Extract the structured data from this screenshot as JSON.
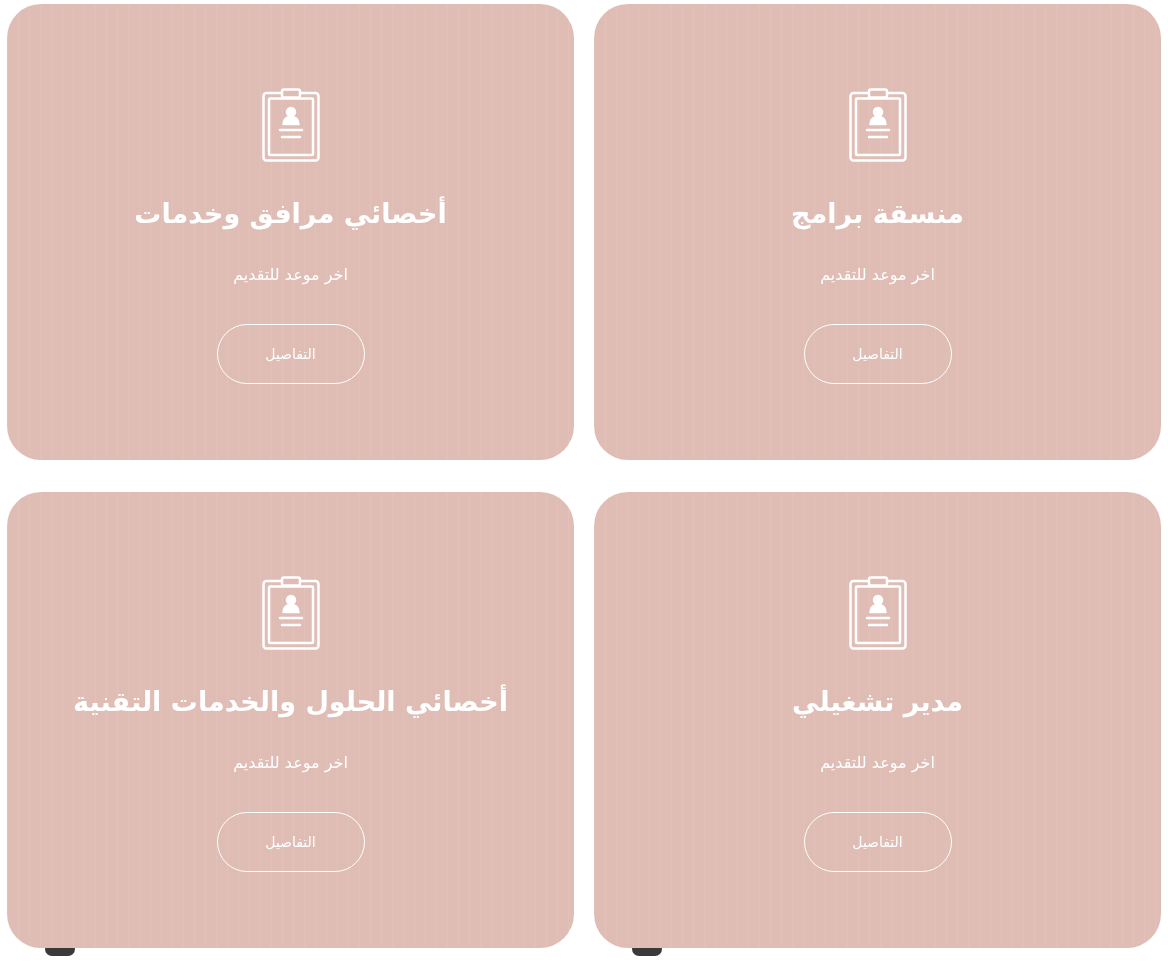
{
  "cards": [
    {
      "title": "منسقة برامج",
      "subtitle": "اخر موعد للتقديم",
      "button": "التفاصيل"
    },
    {
      "title": "أخصائي مرافق وخدمات",
      "subtitle": "اخر موعد للتقديم",
      "button": "التفاصيل"
    },
    {
      "title": "مدير تشغيلي",
      "subtitle": "اخر موعد للتقديم",
      "button": "التفاصيل"
    },
    {
      "title": "أخصائي الحلول والخدمات التقنية",
      "subtitle": "اخر موعد للتقديم",
      "button": "التفاصيل"
    }
  ]
}
